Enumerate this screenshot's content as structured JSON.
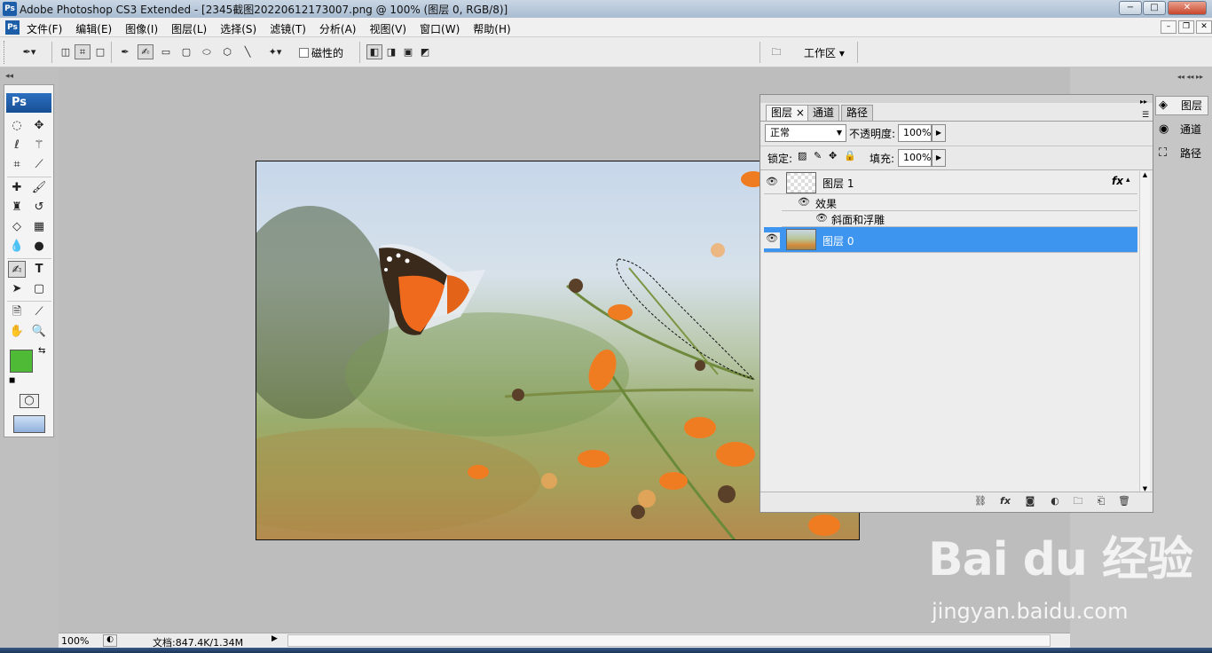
{
  "titlebar": {
    "app_icon": "Ps",
    "title": "Adobe Photoshop CS3 Extended - [2345截图20220612173007.png @ 100% (图层 0, RGB/8)]",
    "minimize": "−",
    "maximize": "□",
    "close": "✕"
  },
  "menubar": {
    "icon": "Ps",
    "items": [
      "文件(F)",
      "编辑(E)",
      "图像(I)",
      "图层(L)",
      "选择(S)",
      "滤镜(T)",
      "分析(A)",
      "视图(V)",
      "窗口(W)",
      "帮助(H)"
    ],
    "doc_minimize": "–",
    "doc_restore": "❐",
    "doc_close": "✕"
  },
  "options_bar": {
    "magnetic_label": "磁性的",
    "workspace_label": "工作区 ▾"
  },
  "toolbox": {
    "logo": "Ps",
    "foreground_color": "#4fba36",
    "background_color": "#ffffff"
  },
  "layers_panel": {
    "tabs": [
      "图层",
      "通道",
      "路径"
    ],
    "tab_close": "×",
    "blend_mode": "正常",
    "opacity_label": "不透明度:",
    "opacity_value": "100%",
    "lock_label": "锁定:",
    "fill_label": "填充:",
    "fill_value": "100%",
    "layers": [
      {
        "name": "图层 1",
        "has_fx": true,
        "fx_label": "fx",
        "selected": false
      },
      {
        "name": "图层 0",
        "has_fx": false,
        "selected": true
      }
    ],
    "effects_label": "效果",
    "effect_item": "斜面和浮雕"
  },
  "right_dock": {
    "items": [
      "图层",
      "通道",
      "路径"
    ]
  },
  "status_bar": {
    "zoom": "100%",
    "doc_info": "文档:847.4K/1.34M"
  },
  "watermark": {
    "brand": "Bai du 经验",
    "url": "jingyan.baidu.com"
  },
  "colors": {
    "selected_layer": "#3d95f0",
    "accent": "#1c5fa8"
  }
}
